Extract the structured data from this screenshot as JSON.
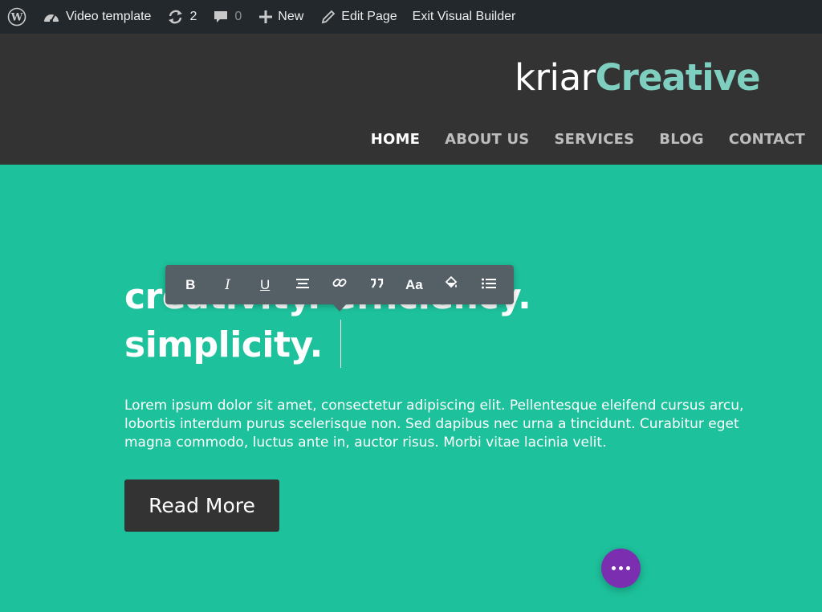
{
  "adminbar": {
    "site_name": "Video template",
    "updates_count": "2",
    "comments_count": "0",
    "new_label": "New",
    "edit_label": "Edit Page",
    "exit_label": "Exit Visual Builder"
  },
  "header": {
    "logo_part1": "kriar",
    "logo_part2": "Creative",
    "nav": [
      {
        "label": "HOME",
        "active": true
      },
      {
        "label": "ABOUT US"
      },
      {
        "label": "SERVICES"
      },
      {
        "label": "BLOG"
      },
      {
        "label": "CONTACT"
      }
    ]
  },
  "hero": {
    "title_line1": "creativity. efficiency.",
    "title_line2": "simplicity.",
    "body": "Lorem ipsum dolor sit amet, consectetur adipiscing elit. Pellentesque eleifend cursus arcu, lobortis interdum purus scelerisque non. Sed dapibus nec urna a tincidunt. Curabitur eget magna commodo, luctus ante in, auctor risus. Morbi vitae lacinia velit.",
    "button_label": "Read More"
  },
  "toolbar": {
    "bold": "B",
    "italic": "I",
    "underline": "U",
    "textsize": "Aa"
  },
  "colors": {
    "accent": "#1dc19b",
    "header_bg": "#333333",
    "adminbar_bg": "#23282d",
    "fab": "#7b2fb0"
  }
}
